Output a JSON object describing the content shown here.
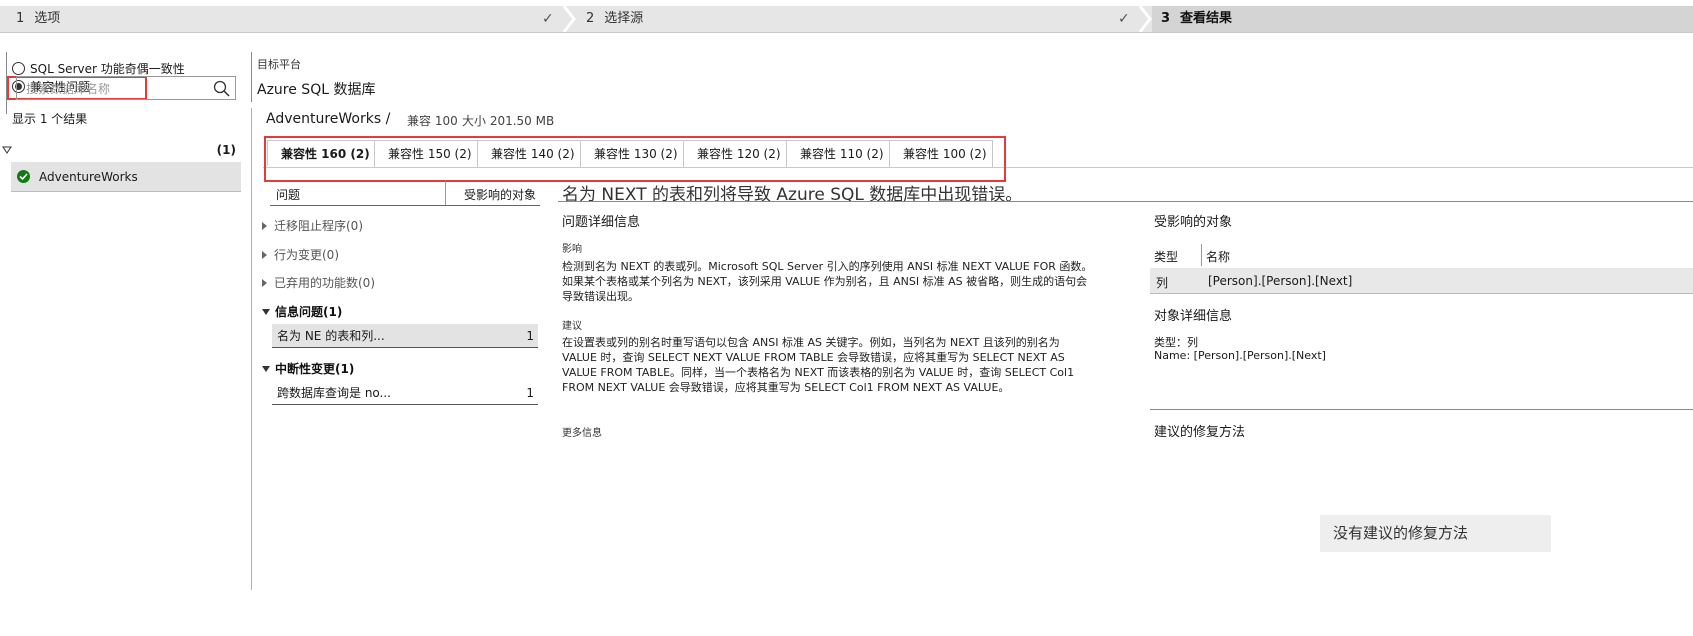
{
  "wizard": {
    "steps": [
      {
        "num": "1",
        "label": "选项",
        "done": true
      },
      {
        "num": "2",
        "label": "选择源",
        "done": true
      },
      {
        "num": "3",
        "label": "查看结果",
        "done": false
      }
    ],
    "check_glyph": "✓"
  },
  "options": {
    "radio1_label": "SQL Server 功能奇偶一致性",
    "radio2_label": "兼容性问题",
    "selected": 2
  },
  "search": {
    "placeholder": "搜索数据库名称",
    "icon": "search-icon"
  },
  "results": {
    "count_text": "显示 1 个结果",
    "group_count": "(1)",
    "db_name": "AdventureWorks",
    "status_icon": "check-circle-icon",
    "status_color": "#107c10"
  },
  "target": {
    "label": "目标平台",
    "platform": "Azure SQL 数据库"
  },
  "db_header": {
    "name": "AdventureWorks /",
    "compat": "兼容 100",
    "size": "大小 201.50 MB"
  },
  "tabs": [
    "兼容性 160 (2)",
    "兼容性 150 (2)",
    "兼容性 140 (2)",
    "兼容性 130 (2)",
    "兼容性 120 (2)",
    "兼容性 110 (2)",
    "兼容性 100 (2)"
  ],
  "issues_panel": {
    "col_issue": "问题",
    "col_affected": "受影响的对象",
    "categories": [
      {
        "label": "迁移阻止程序(0)",
        "expanded": false
      },
      {
        "label": "行为变更(0)",
        "expanded": false
      },
      {
        "label": "已弃用的功能数(0)",
        "expanded": false
      },
      {
        "label": "信息问题(1)",
        "expanded": true
      },
      {
        "label": "中断性变更(1)",
        "expanded": true
      }
    ],
    "items": [
      {
        "title": "名为 NE 的表和列...",
        "count": "1"
      },
      {
        "title": "跨数据库查询是 no...",
        "count": "1"
      }
    ]
  },
  "detail": {
    "title": "名为 NEXT 的表和列将导致 Azure SQL 数据库中出现错误。",
    "section_title": "问题详细信息",
    "impact_label": "影响",
    "impact_lines": [
      "检测到名为 NEXT 的表或列。Microsoft SQL Server 引入的序列使用 ANSI 标准 NEXT VALUE FOR 函数。",
      "如果某个表格或某个列名为 NEXT，该列采用 VALUE 作为别名，且 ANSI 标准 AS 被省略，则生成的语句会",
      "导致错误出现。"
    ],
    "recommend_label": "建议",
    "recommend_lines": [
      "在设置表或列的别名时重写语句以包含 ANSI 标准 AS 关键字。例如，当列名为 NEXT 且该列的别名为",
      "VALUE 时，查询 SELECT NEXT VALUE FROM TABLE 会导致错误，应将其重写为 SELECT NEXT AS",
      "VALUE FROM TABLE。同样，当一个表格名为 NEXT 而该表格的别名为 VALUE 时，查询 SELECT Col1",
      "FROM NEXT VALUE 会导致错误，应将其重写为 SELECT Col1 FROM NEXT AS VALUE。"
    ],
    "more_info": "更多信息"
  },
  "affected": {
    "title": "受影响的对象",
    "col_type": "类型",
    "col_name": "名称",
    "row_type": "列",
    "row_name": "[Person].[Person].[Next]",
    "details_title": "对象详细信息",
    "detail_type": "类型：列",
    "detail_name": "Name: [Person].[Person].[Next]",
    "fix_title": "建议的修复方法",
    "no_fix": "没有建议的修复方法"
  },
  "annotation_color": "#e33b3b"
}
